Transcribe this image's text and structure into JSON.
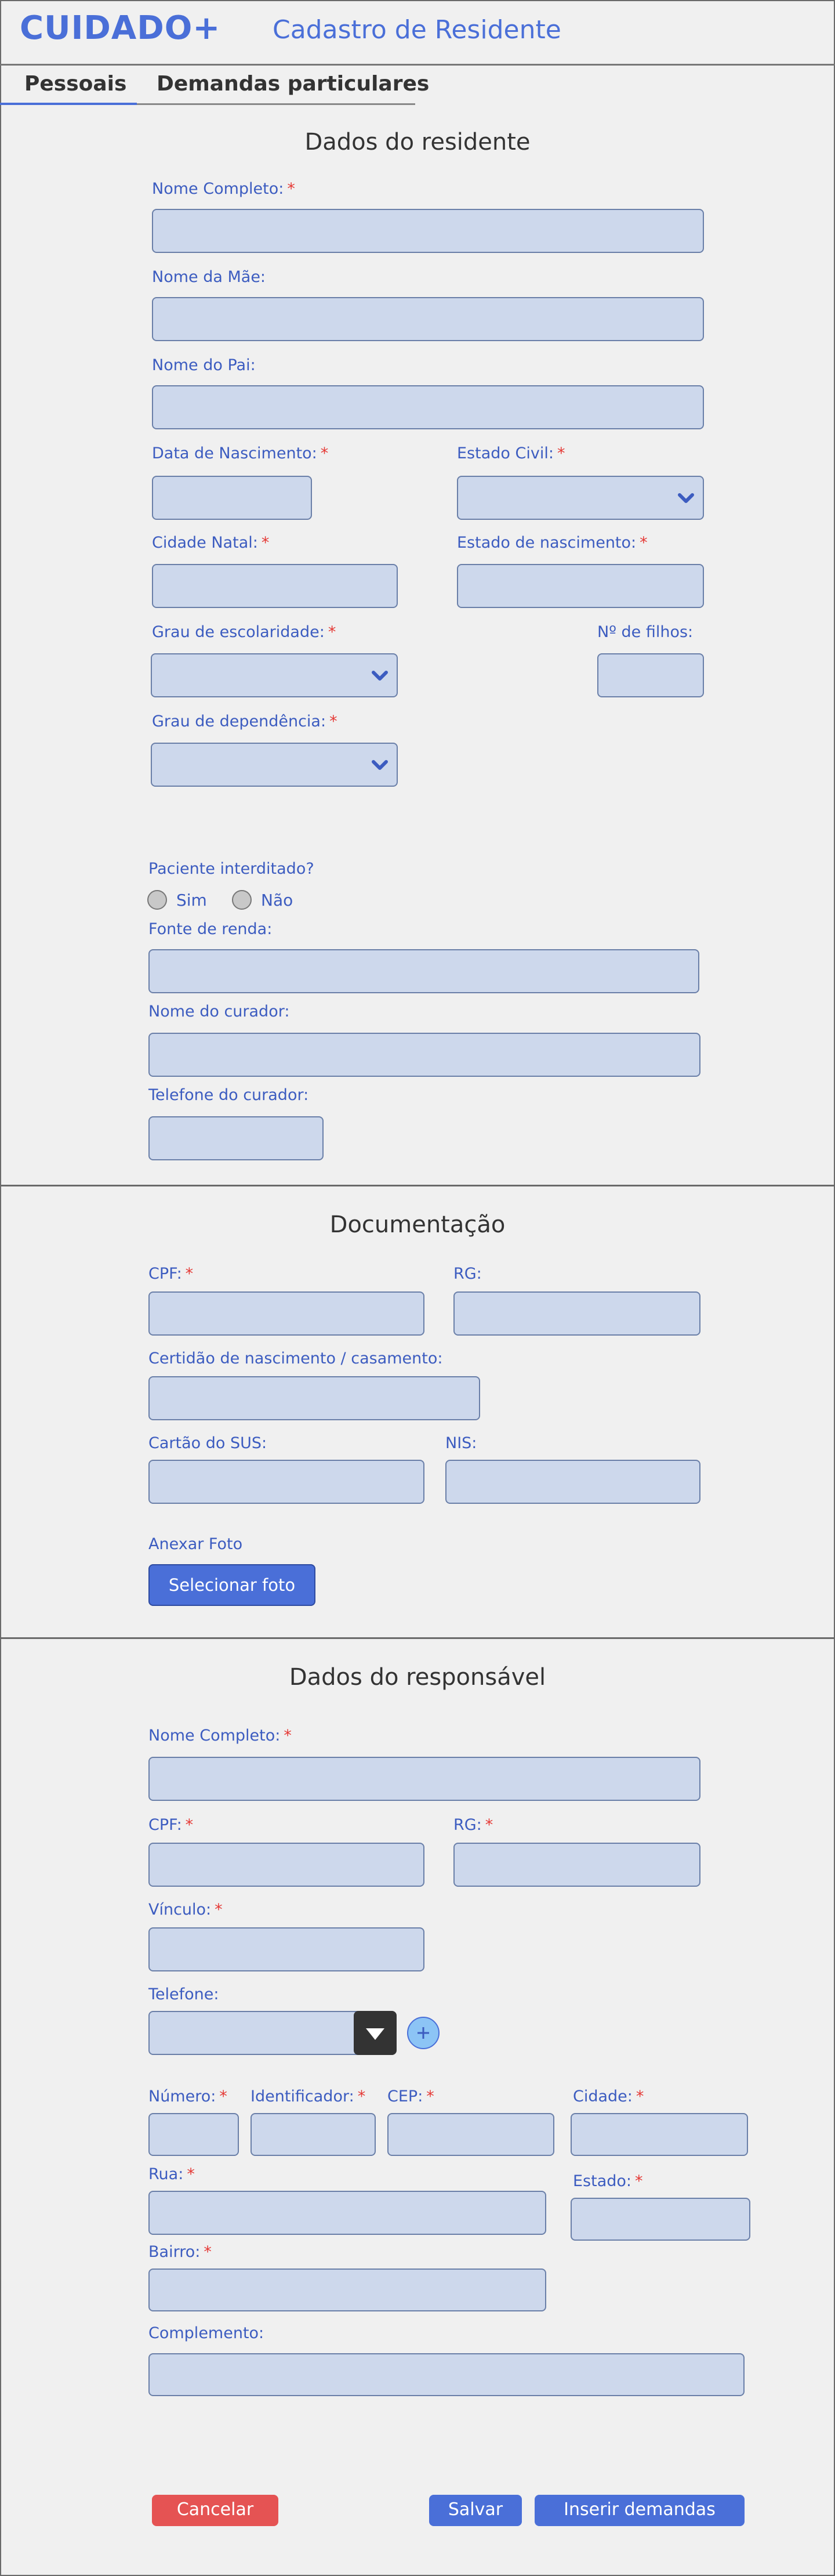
{
  "header": {
    "logo": "CUIDADO+",
    "title": "Cadastro de Residente"
  },
  "tabs": [
    {
      "label": "Pessoais",
      "active": true
    },
    {
      "label": "Demandas particulares",
      "active": false
    }
  ],
  "resident": {
    "title": "Dados do residente",
    "nome_completo": "Nome Completo:",
    "nome_mae": "Nome da Mãe:",
    "nome_pai": "Nome do Pai:",
    "data_nascimento": "Data de Nascimento:",
    "estado_civil": "Estado Civil:",
    "cidade_natal": "Cidade Natal:",
    "estado_nascimento": "Estado de nascimento:",
    "grau_escolaridade": "Grau de escolaridade:",
    "num_filhos": "Nº de filhos:",
    "grau_dependencia": "Grau de dependência:",
    "interditado": "Paciente interditado?",
    "sim": "Sim",
    "nao": "Não",
    "fonte_renda": "Fonte de renda:",
    "nome_curador": "Nome do curador:",
    "telefone_curador": "Telefone do curador:"
  },
  "docs": {
    "title": "Documentação",
    "cpf": "CPF:",
    "rg": "RG:",
    "certidao": "Certidão de nascimento / casamento:",
    "sus": "Cartão do SUS:",
    "nis": "NIS:",
    "anexar": "Anexar Foto",
    "selecionar": "Selecionar foto"
  },
  "responsible": {
    "title": "Dados do responsável",
    "nome_completo": "Nome Completo:",
    "cpf": "CPF:",
    "rg": "RG:",
    "vinculo": "Vínculo:",
    "telefone": "Telefone:",
    "numero": "Número:",
    "identificador": "Identificador:",
    "cep": "CEP:",
    "cidade": "Cidade:",
    "rua": "Rua:",
    "estado": "Estado:",
    "bairro": "Bairro:",
    "complemento": "Complemento:"
  },
  "actions": {
    "cancelar": "Cancelar",
    "salvar": "Salvar",
    "inserir": "Inserir demandas"
  },
  "required_marker": "*",
  "colors": {
    "accent": "#4a6fd8",
    "field": "#cdd8ec",
    "required": "#e53935",
    "danger": "#e55353"
  }
}
